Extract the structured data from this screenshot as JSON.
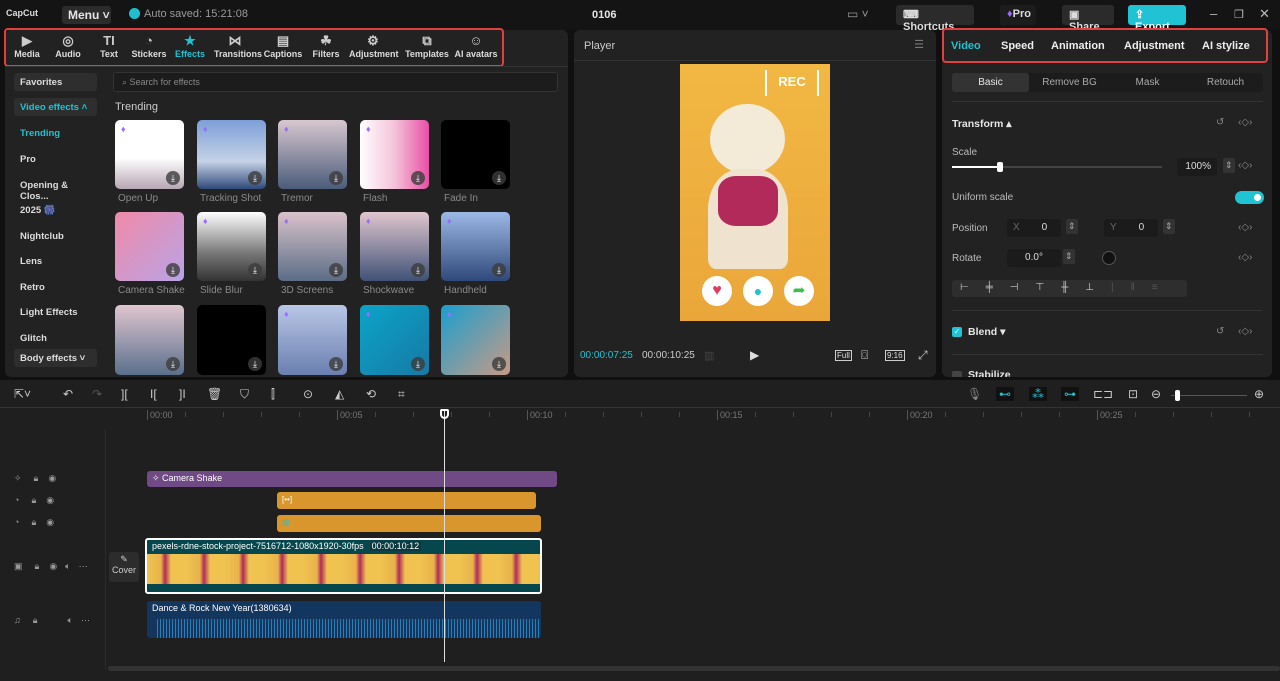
{
  "topbar": {
    "logo": "CapCut",
    "menu": "Menu",
    "autosave": "Auto saved: 15:21:08",
    "project_title": "0106",
    "shortcuts": "Shortcuts",
    "pro": "Pro",
    "share": "Share",
    "export": "Export"
  },
  "media_toolbar": [
    {
      "label": "Media",
      "icon": "media-icon"
    },
    {
      "label": "Audio",
      "icon": "audio-icon"
    },
    {
      "label": "Text",
      "icon": "text-icon"
    },
    {
      "label": "Stickers",
      "icon": "sticker-icon"
    },
    {
      "label": "Effects",
      "icon": "effects-icon",
      "active": true
    },
    {
      "label": "Transitions",
      "icon": "transitions-icon"
    },
    {
      "label": "Captions",
      "icon": "captions-icon"
    },
    {
      "label": "Filters",
      "icon": "filters-icon"
    },
    {
      "label": "Adjustment",
      "icon": "adjustment-icon"
    },
    {
      "label": "Templates",
      "icon": "templates-icon"
    },
    {
      "label": "AI avatars",
      "icon": "avatar-icon"
    }
  ],
  "sidebar": {
    "items": [
      "Favorites",
      "Video effects",
      "Trending",
      "Pro",
      "Opening & Clos...",
      "2025 🎆",
      "Nightclub",
      "Lens",
      "Retro",
      "Light Effects",
      "Glitch",
      "Body effects"
    ]
  },
  "effects": {
    "search_placeholder": "Search for effects",
    "section": "Trending",
    "items": [
      {
        "name": "Open Up",
        "pro": true
      },
      {
        "name": "Tracking Shot",
        "pro": true
      },
      {
        "name": "Tremor",
        "pro": true
      },
      {
        "name": "Flash",
        "pro": true
      },
      {
        "name": "Fade In",
        "pro": false
      },
      {
        "name": "Camera Shake",
        "pro": false
      },
      {
        "name": "Slide Blur",
        "pro": true
      },
      {
        "name": "3D Screens",
        "pro": true
      },
      {
        "name": "Shockwave",
        "pro": true
      },
      {
        "name": "Handheld",
        "pro": true
      },
      {
        "name": "",
        "pro": false
      },
      {
        "name": "",
        "pro": false
      },
      {
        "name": "",
        "pro": true
      },
      {
        "name": "",
        "pro": true
      },
      {
        "name": "",
        "pro": true
      }
    ]
  },
  "player": {
    "title": "Player",
    "rec": "REC",
    "current_time": "00:00:07:25",
    "total_time": "00:00:10:25",
    "full": "Full",
    "ratio": "9:16"
  },
  "inspector": {
    "tabs": [
      "Video",
      "Speed",
      "Animation",
      "Adjustment",
      "AI stylize"
    ],
    "subtabs": [
      "Basic",
      "Remove BG",
      "Mask",
      "Retouch"
    ],
    "transform": "Transform",
    "scale_label": "Scale",
    "scale_value": "100%",
    "scale_fraction": 0.23,
    "uniform_scale": "Uniform scale",
    "uniform_on": true,
    "position_label": "Position",
    "x_label": "X",
    "x_value": "0",
    "y_label": "Y",
    "y_value": "0",
    "rotate_label": "Rotate",
    "rotate_value": "0.0°",
    "blend": "Blend",
    "stabilize": "Stabilize"
  },
  "timeline": {
    "ticks": [
      "00:00",
      "00:05",
      "00:10",
      "00:15",
      "00:20",
      "00:25"
    ],
    "effect_clip": "Camera Shake",
    "video_clip": "pexels-rdne-stock-project-7516712-1080x1920-30fps",
    "video_duration": "00:00:10:12",
    "audio_clip": "Dance & Rock New Year(1380634)",
    "cover": "Cover"
  },
  "colors": {
    "accent": "#1fc3d3",
    "effect_clip": "#6f4a85",
    "sticker_clip": "#d9962c",
    "video_clip": "#06474d",
    "audio_clip": "#13365e"
  }
}
